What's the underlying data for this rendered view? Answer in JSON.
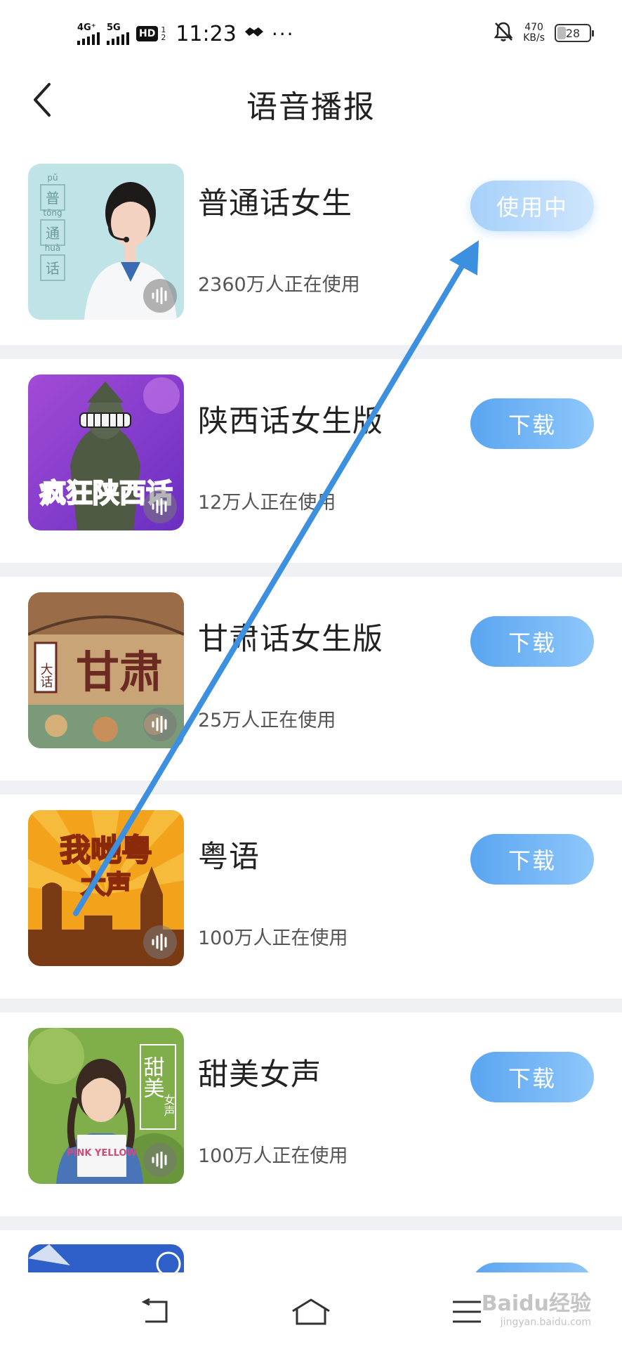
{
  "status_bar": {
    "sim1": "4G⁺",
    "sim2": "5G",
    "hd": "HD",
    "hd_slot_top": "1",
    "hd_slot_bottom": "2",
    "time": "11:23",
    "dots": "···",
    "speed_value": "470",
    "speed_unit": "KB/s",
    "battery": "28"
  },
  "header": {
    "title": "语音播报"
  },
  "voices": [
    {
      "name": "普通话女生",
      "users": "2360万人正在使用",
      "button": "使用中",
      "state": "in-use",
      "thumb_pinyin": [
        "pǔ",
        "tōng",
        "huà"
      ],
      "thumb_chars": [
        "普",
        "通",
        "话"
      ]
    },
    {
      "name": "陕西话女生版",
      "users": "12万人正在使用",
      "button": "下载",
      "state": "download",
      "thumb_text": "疯狂陕西话"
    },
    {
      "name": "甘肃话女生版",
      "users": "25万人正在使用",
      "button": "下载",
      "state": "download",
      "thumb_text": "甘肃",
      "thumb_side_text": "大话"
    },
    {
      "name": "粤语",
      "users": "100万人正在使用",
      "button": "下载",
      "state": "download",
      "thumb_text": "我哋粤",
      "thumb_text2": "大声"
    },
    {
      "name": "甜美女声",
      "users": "100万人正在使用",
      "button": "下载",
      "state": "download",
      "thumb_text": "甜美",
      "thumb_side_text": "女声",
      "thumb_shirt_text": "PINK YELLOW"
    }
  ],
  "watermark": {
    "brand": "Baidu经验",
    "url": "jingyan.baidu.com"
  },
  "colors": {
    "download_button": "#5aa5f0",
    "in_use_button": "#a6d0fa",
    "separator": "#eff1f4",
    "annotation_arrow": "#3d8fe0"
  }
}
